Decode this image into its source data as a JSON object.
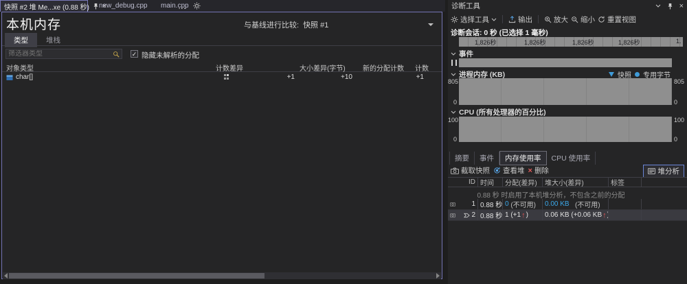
{
  "editor": {
    "tabs": {
      "snapshot": "快照 #2 堆 Me...xe (0.88 秒)",
      "new_debug": "new_debug.cpp",
      "main": "main.cpp"
    },
    "overflow": "…",
    "close": "×"
  },
  "doc": {
    "title": "本机内存",
    "compare_label": "与基线进行比较:",
    "compare_value": "快照 #1",
    "tabs": {
      "types": "类型",
      "stacks": "堆栈"
    },
    "filter_placeholder": "筛选器类型",
    "hide_unresolved_label": "隐藏未解析的分配",
    "checkbox_mark": "✓",
    "columns": {
      "object_type": "对象类型",
      "count_diff": "计数差异",
      "size_diff": "大小差异(字节)",
      "new_alloc_count": "新的分配计数",
      "count": "计数"
    },
    "row": {
      "type": "char[]",
      "count_diff": "+1",
      "size_diff": "+10",
      "count": "+1"
    }
  },
  "diag": {
    "title": "诊断工具",
    "close": "×",
    "toolbar": {
      "select_tool": "选择工具",
      "output": "输出",
      "zoom_in": "放大",
      "zoom_out": "缩小",
      "reset_view": "重置视图"
    },
    "session": "诊断会话: 0 秒 (已选择 1 毫秒)",
    "ruler": {
      "t1": "1,826秒",
      "t2": "1,826秒",
      "t3": "1,826秒",
      "t4": "1,826秒",
      "t5": "1."
    },
    "events": {
      "title": "事件"
    },
    "memory": {
      "title": "进程内存 (KB)",
      "legend_snapshot": "快照",
      "legend_private": "专用字节",
      "max": "805",
      "min": "0"
    },
    "cpu": {
      "title": "CPU (所有处理器的百分比)",
      "max": "100",
      "min": "0"
    },
    "tabs": {
      "summary": "摘要",
      "events": "事件",
      "memory": "内存使用率",
      "cpu": "CPU 使用率"
    },
    "actions": {
      "take_snapshot": "截取快照",
      "view_heap": "查看堆",
      "delete": "删除",
      "heap_analysis": "堆分析"
    },
    "table": {
      "headers": {
        "id": "ID",
        "time": "时间",
        "alloc": "分配(差异)",
        "heap": "堆大小(差异)",
        "tag": "标签"
      },
      "notice": "0.88 秒 时启用了本机堆分析，不包含之前的分配",
      "rows": [
        {
          "id": "1",
          "time": "0.88 秒",
          "alloc_link": "0",
          "alloc_rest": "(不可用)",
          "heap_link": "0.00 KB",
          "heap_rest": "(不可用)"
        },
        {
          "id": "2",
          "time": "0.88 秒",
          "alloc_pre": "1 (+1",
          "arrow": "↑",
          "alloc_post": ")",
          "heap_pre": "0.06 KB (+0.06 KB",
          "heap_post": ")"
        }
      ]
    }
  }
}
